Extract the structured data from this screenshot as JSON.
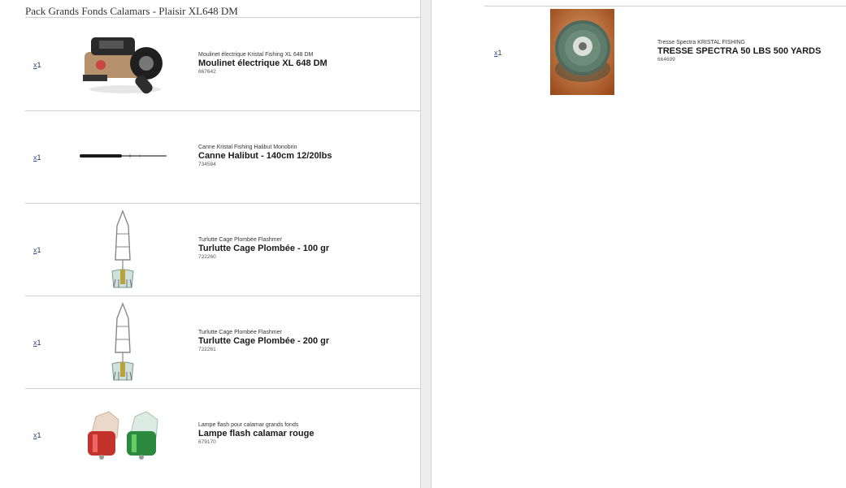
{
  "document": {
    "title": "Pack Grands Fonds Calamars - Plaisir XL648 DM"
  },
  "items": [
    {
      "qty_prefix": "x",
      "qty_value": "1",
      "subtitle": "Moulinet électrique Kristal Fishing XL 648 DM",
      "name": "Moulinet électrique XL 648 DM",
      "code": "667642",
      "image": "electric-reel-icon"
    },
    {
      "qty_prefix": "x",
      "qty_value": "1",
      "subtitle": "Canne Kristal Fishing Halibut Monobrin",
      "name": "Canne Halibut - 140cm 12/20lbs",
      "code": "734584",
      "image": "fishing-rod-icon"
    },
    {
      "qty_prefix": "x",
      "qty_value": "1",
      "subtitle": "Turlutte Cage Plombée Flashmer",
      "name": "Turlutte Cage Plombée - 100 gr",
      "code": "722260",
      "image": "squid-jig-icon"
    },
    {
      "qty_prefix": "x",
      "qty_value": "1",
      "subtitle": "Turlutte Cage Plombée Flashmer",
      "name": "Turlutte Cage Plombée - 200 gr",
      "code": "722261",
      "image": "squid-jig-icon"
    },
    {
      "qty_prefix": "x",
      "qty_value": "1",
      "subtitle": "Lampe flash pour calamar grands fonds",
      "name": "Lampe flash calamar rouge",
      "code": "679170",
      "image": "flash-lamp-icon"
    }
  ],
  "right_item": {
    "qty_prefix": "x",
    "qty_value": "1",
    "subtitle": "Tresse Spectra KRISTAL FISHING",
    "name": "TRESSE SPECTRA 50 LBS 500 YARDS",
    "code": "664699",
    "image": "braid-spool-icon"
  },
  "colors": {
    "rule": "#cfcfcf",
    "page_gap": "#ededed",
    "spellcheck": "#d02020"
  }
}
